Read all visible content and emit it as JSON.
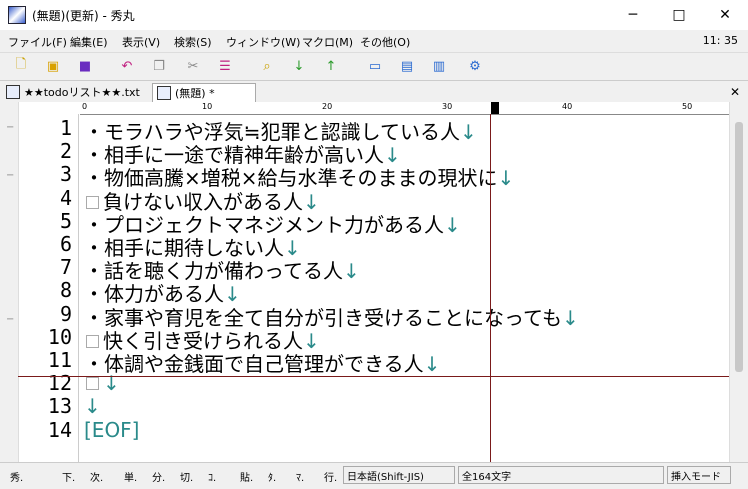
{
  "window": {
    "title": "(無題)(更新) - 秀丸"
  },
  "menu": [
    "ファイル(F)",
    "編集(E)",
    "表示(V)",
    "検索(S)",
    "ウィンドウ(W)",
    "マクロ(M)",
    "その他(O)"
  ],
  "clock": "11: 35",
  "toolbar": [
    "new-file-icon",
    "open-folder-icon",
    "save-icon",
    "undo-icon",
    "copy-icon",
    "cut-icon",
    "paste-icon",
    "find-icon",
    "find-down-icon",
    "find-up-icon",
    "window-icon",
    "split-h-icon",
    "split-v-icon",
    "settings-icon"
  ],
  "tabs": [
    {
      "label": "★★todoリスト★★.txt"
    },
    {
      "label": "(無題) *"
    }
  ],
  "ruler": [
    "0",
    "10",
    "20",
    "30",
    "40",
    "50"
  ],
  "lines": [
    {
      "num": "1",
      "text": "・モラハラや浮気≒犯罪と認識している人",
      "ret": "↓",
      "box": false
    },
    {
      "num": "2",
      "text": "・相手に一途で精神年齢が高い人",
      "ret": "↓",
      "box": false
    },
    {
      "num": "3",
      "text": "・物価高騰×増税×給与水準そのままの現状に",
      "ret": "↓",
      "box": false
    },
    {
      "num": "4",
      "text": "負けない収入がある人",
      "ret": "↓",
      "box": true
    },
    {
      "num": "5",
      "text": "・プロジェクトマネジメント力がある人",
      "ret": "↓",
      "box": false
    },
    {
      "num": "6",
      "text": "・相手に期待しない人",
      "ret": "↓",
      "box": false
    },
    {
      "num": "7",
      "text": "・話を聴く力が備わってる人",
      "ret": "↓",
      "box": false
    },
    {
      "num": "8",
      "text": "・体力がある人",
      "ret": "↓",
      "box": false
    },
    {
      "num": "9",
      "text": "・家事や育児を全て自分が引き受けることになっても",
      "ret": "↓",
      "box": false
    },
    {
      "num": "10",
      "text": "快く引き受けられる人",
      "ret": "↓",
      "box": true
    },
    {
      "num": "11",
      "text": "・体調や金銭面で自己管理ができる人",
      "ret": "↓",
      "box": false
    },
    {
      "num": "12",
      "text": "",
      "ret": "↓",
      "box": true
    },
    {
      "num": "13",
      "text": "",
      "ret": "↓",
      "box": false
    },
    {
      "num": "14",
      "text": "[EOF]",
      "ret": "",
      "box": false
    }
  ],
  "status": {
    "buttons": [
      "秀.",
      "下.",
      "次.",
      "単.",
      "分.",
      "切.",
      "ｺ.",
      "貼.",
      "ﾀ.",
      "ﾏ.",
      "行."
    ],
    "encoding": "日本語(Shift-JIS)",
    "chars": "全164文字",
    "mode": "挿入モード"
  }
}
